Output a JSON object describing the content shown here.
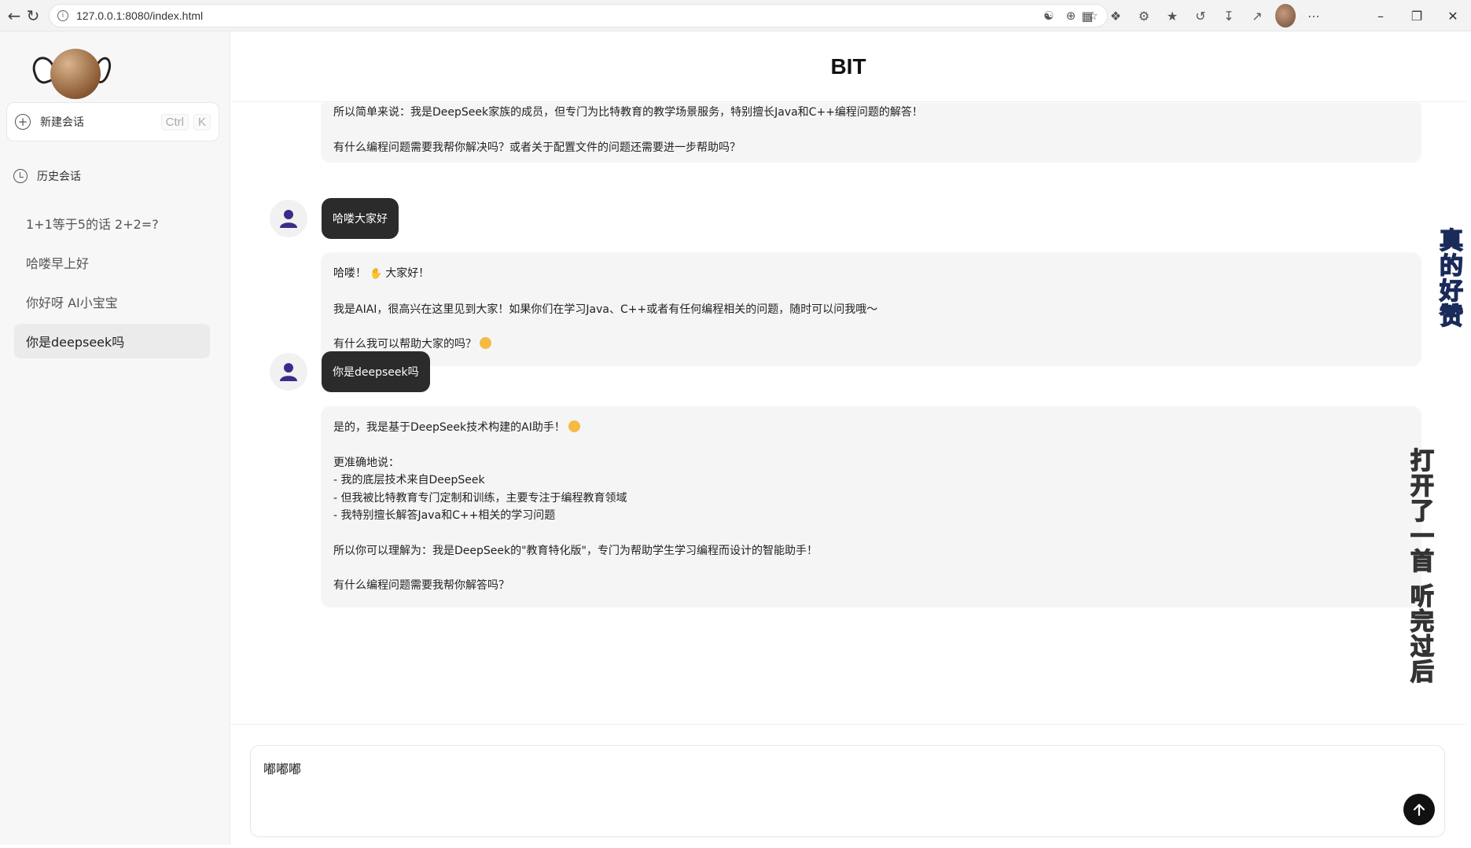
{
  "browser": {
    "url": "127.0.0.1:8080/index.html",
    "back_icon": "back-arrow-icon",
    "reload_icon": "reload-icon"
  },
  "sidebar": {
    "new_chat_label": "新建会话",
    "shortcut_mod": "Ctrl",
    "shortcut_key": "K",
    "history_label": "历史会话",
    "items": [
      {
        "label": "1+1等于5的话 2+2=?"
      },
      {
        "label": "哈喽早上好"
      },
      {
        "label": "你好呀 AI小宝宝"
      },
      {
        "label": "你是deepseek吗"
      }
    ]
  },
  "header": {
    "title": "BIT"
  },
  "messages": {
    "m0": {
      "p1": "所以简单来说：我是DeepSeek家族的成员，但专门为比特教育的教学场景服务，特别擅长Java和C++编程问题的解答！",
      "p2": "有什么编程问题需要我帮你解决吗？或者关于配置文件的问题还需要进一步帮助吗？"
    },
    "u1": "哈喽大家好",
    "m1": {
      "p1a": "哈喽！",
      "p1b": "大家好！",
      "p2": "我是AIAI，很高兴在这里见到大家！如果你们在学习Java、C++或者有任何编程相关的问题，随时可以问我哦～",
      "p3": "有什么我可以帮助大家的吗？"
    },
    "u2": "你是deepseek吗",
    "m2": {
      "p1": "是的，我是基于DeepSeek技术构建的AI助手！",
      "p2": "更准确地说：",
      "l1": "- 我的底层技术来自DeepSeek",
      "l2": "- 但我被比特教育专门定制和训练，主要专注于编程教育领域",
      "l3": "- 我特别擅长解答Java和C++相关的学习问题",
      "p3": "所以你可以理解为：我是DeepSeek的\"教育特化版\"，专门为帮助学生学习编程而设计的智能助手！",
      "p4": "有什么编程问题需要我帮你解答吗？"
    }
  },
  "input": {
    "value": "嘟嘟嘟"
  },
  "overlay": {
    "text_a": "真的好赞",
    "text_b": "打开了一首 听完过后"
  }
}
